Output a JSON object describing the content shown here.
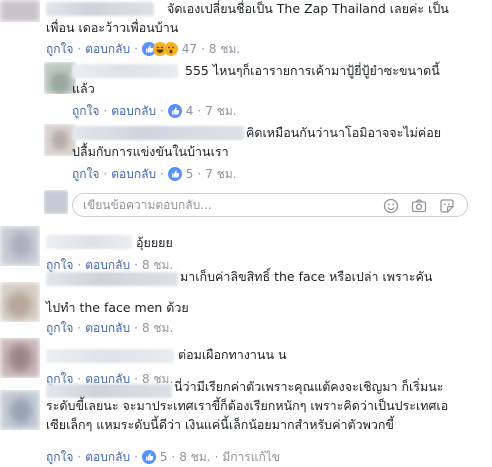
{
  "comments": [
    {
      "text_lines": [
        "จัดเองเปลี่ยนชื่อเป็น The Zap Thailand เลยค่ะ เป็น",
        "เพื่อน เดอะว้าวเพื่อนบ้าน"
      ],
      "like": "ถูกใจ",
      "reply": "ตอบกลับ",
      "reactions": "47",
      "time": "8 ชม."
    },
    {
      "text_lines": [
        "555 ไหนๆก็เอารายการเค้ามาปู้ยี่ปู้ยำซะขนาดนี้",
        "แล้ว"
      ],
      "like": "ถูกใจ",
      "reply": "ตอบกลับ",
      "reactions": "4",
      "time": "7 ชม."
    },
    {
      "text_lines": [
        "คิดเหมือนกันว่านาโอมิอาจจะไม่ค่อย",
        "ปลื้มกับการแข่งขันในบ้านเรา"
      ],
      "like": "ถูกใจ",
      "reply": "ตอบกลับ",
      "reactions": "5",
      "time": "7 ชม."
    },
    {
      "text_lines": [
        "อุ้ยยยย"
      ],
      "like": "ถูกใจ",
      "reply": "ตอบกลับ",
      "time": "8 ชม."
    },
    {
      "text_lines": [
        "มาเก็บค่าลิขสิทธิ์ the face หรือเปล่า เพราะคัน",
        "ไปทำ the face men ด้วย"
      ],
      "like": "ถูกใจ",
      "reply": "ตอบกลับ",
      "time": "8 ชม."
    },
    {
      "text_lines": [
        "ต่อมเผือกทางานน น"
      ],
      "like": "ถูกใจ",
      "reply": "ตอบกลับ",
      "time": "8 ชม."
    },
    {
      "text_lines": [
        "นี่ว่ามีเรียกค่าตัวเพราะคุณแต้คงจะเชิญมา ก็เริ่มนะ",
        "ระดับขี้เลยนะ จะมาประเทศเราขี้ก็ต้องเรียกหนักๆ เพราะคิดว่าเป็นประเทศเอ",
        "เซียเล็กๆ แหมระดับนี้ดีว่า เงินแค่นี้เล็กน้อยมากสำหรับค่าตัวพวกขี้"
      ],
      "like": "ถูกใจ",
      "reply": "ตอบกลับ",
      "reactions": "5",
      "time": "8 ชม.",
      "edited": "มีการแก้ไข"
    }
  ],
  "reply_box": {
    "placeholder": "เขียนข้อความตอบกลับ..."
  },
  "separator": "·",
  "icons": [
    "like-reaction-icon",
    "haha-reaction-icon",
    "wow-reaction-icon",
    "emoji-icon",
    "camera-icon",
    "sticker-icon"
  ],
  "colors": {
    "link": "#4267b2",
    "meta": "#90949c",
    "text": "#1d2129",
    "like_blue": "#5890ff",
    "reaction_yellow": "#f7b125"
  }
}
